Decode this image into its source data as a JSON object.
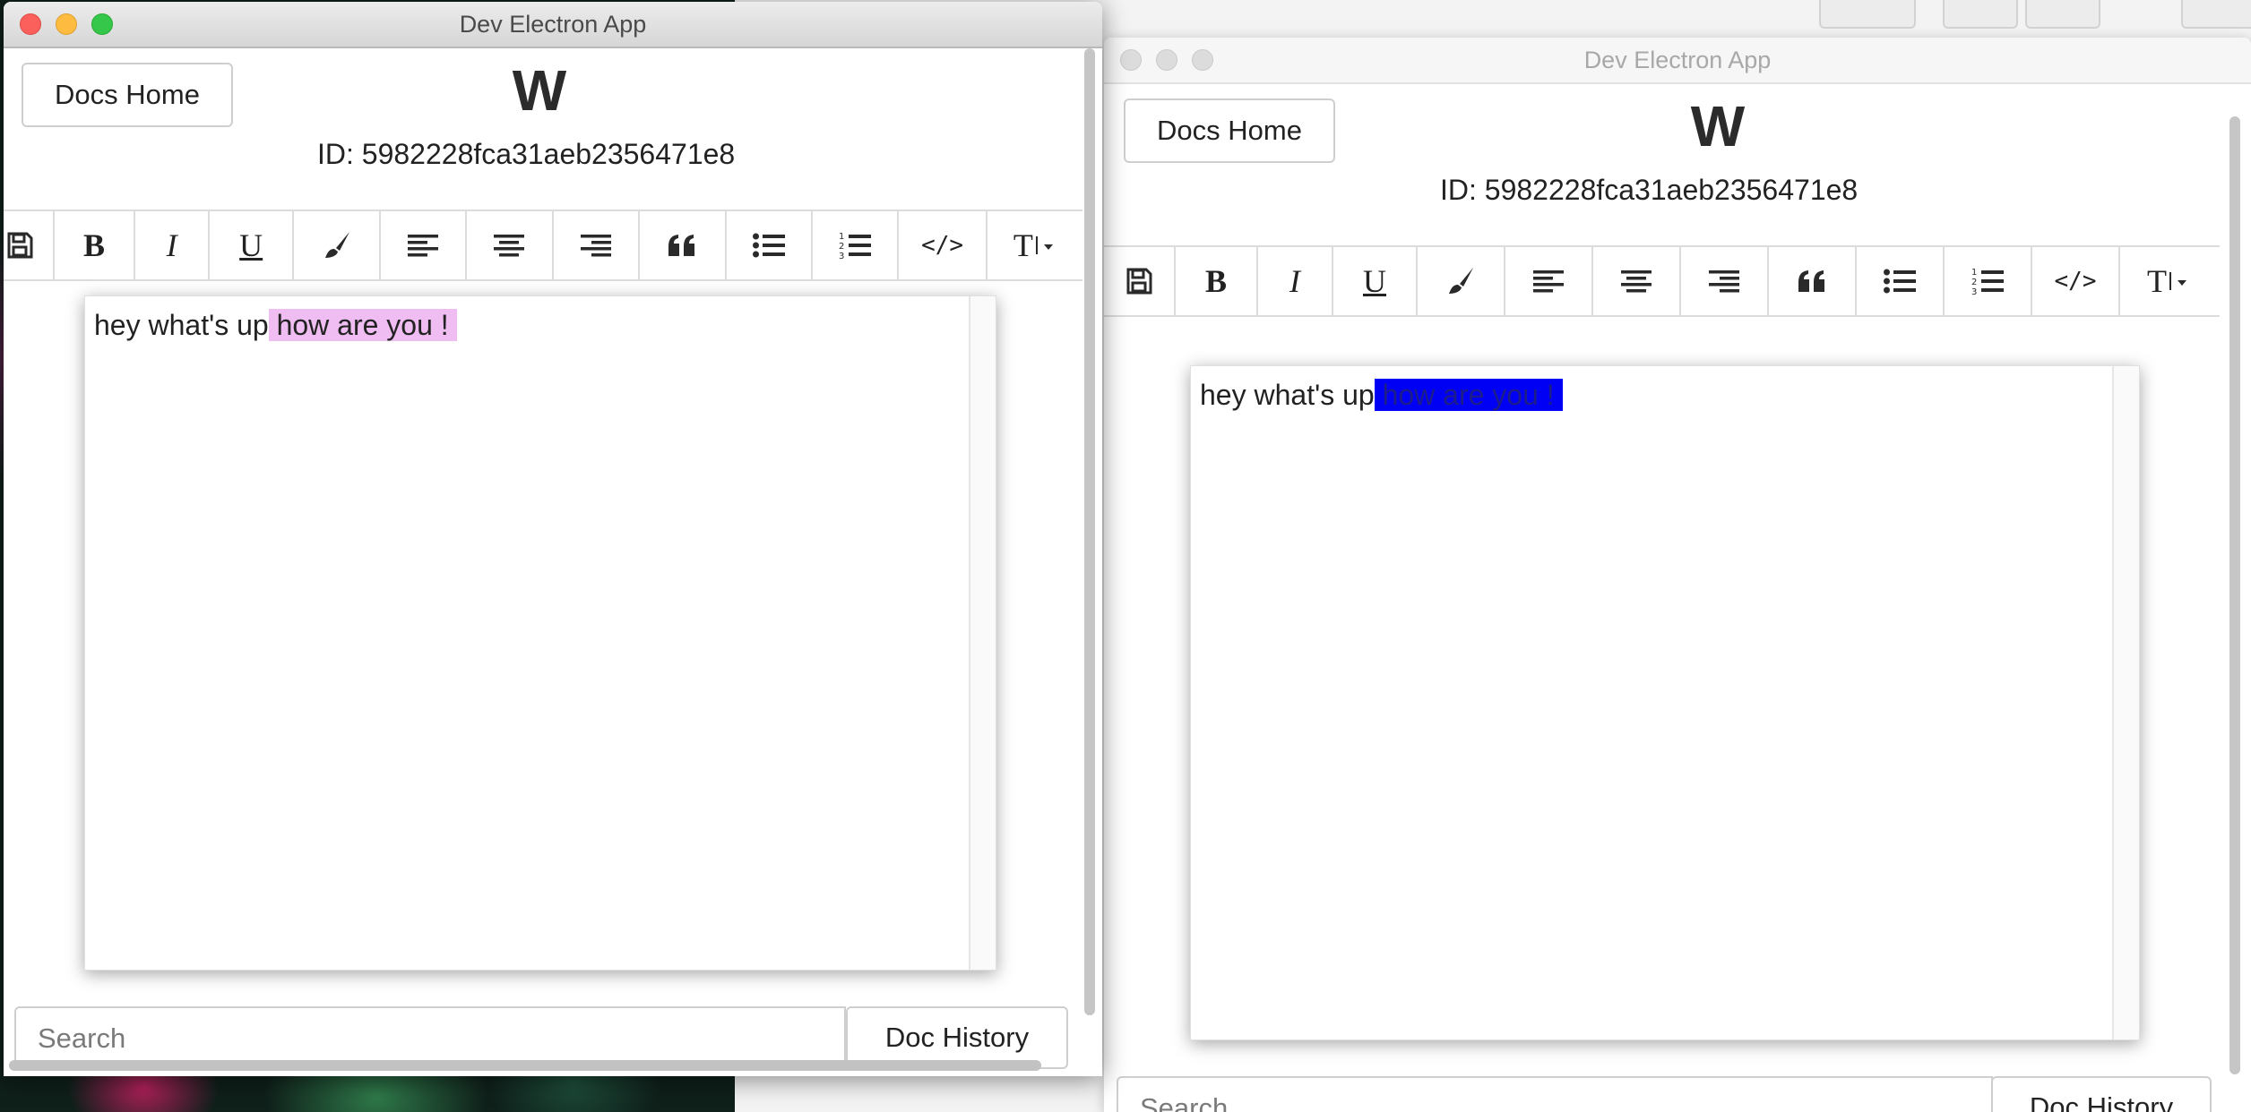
{
  "windows": [
    {
      "title": "Dev Electron App",
      "docs_home_label": "Docs Home",
      "doc_title": "W",
      "doc_id": "ID: 5982228fca31aeb2356471e8",
      "editor": {
        "text_plain": "hey what's up",
        "text_highlighted": " how are you ! ",
        "highlight_color": "#efbdf2"
      },
      "search_placeholder": "Search",
      "history_label": "Doc History",
      "focused": true
    },
    {
      "title": "Dev Electron App",
      "docs_home_label": "Docs Home",
      "doc_title": "W",
      "doc_id": "ID: 5982228fca31aeb2356471e8",
      "editor": {
        "text_plain": "hey what's up",
        "text_highlighted": " how are you ! ",
        "highlight_color": "#0000f5"
      },
      "search_placeholder": "Search",
      "history_label": "Doc History",
      "focused": false
    }
  ],
  "toolbar_buttons": [
    {
      "name": "save",
      "icon": "save-icon"
    },
    {
      "name": "bold",
      "label": "B",
      "icon": "bold-icon"
    },
    {
      "name": "italic",
      "label": "I",
      "icon": "italic-icon"
    },
    {
      "name": "underline",
      "label": "U",
      "icon": "underline-icon"
    },
    {
      "name": "highlight",
      "icon": "paintbrush-icon"
    },
    {
      "name": "align-left",
      "icon": "align-left-icon"
    },
    {
      "name": "align-center",
      "icon": "align-center-icon"
    },
    {
      "name": "align-right",
      "icon": "align-right-icon"
    },
    {
      "name": "blockquote",
      "icon": "quote-icon"
    },
    {
      "name": "bullet-list",
      "icon": "list-ul-icon"
    },
    {
      "name": "numbered-list",
      "icon": "list-ol-icon"
    },
    {
      "name": "code",
      "label": "</>",
      "icon": "code-icon"
    },
    {
      "name": "text-size",
      "label": "T",
      "icon": "text-height-icon"
    }
  ],
  "colors": {
    "close": "#fc605c",
    "minimize": "#fdbc40",
    "maximize": "#34c749"
  }
}
